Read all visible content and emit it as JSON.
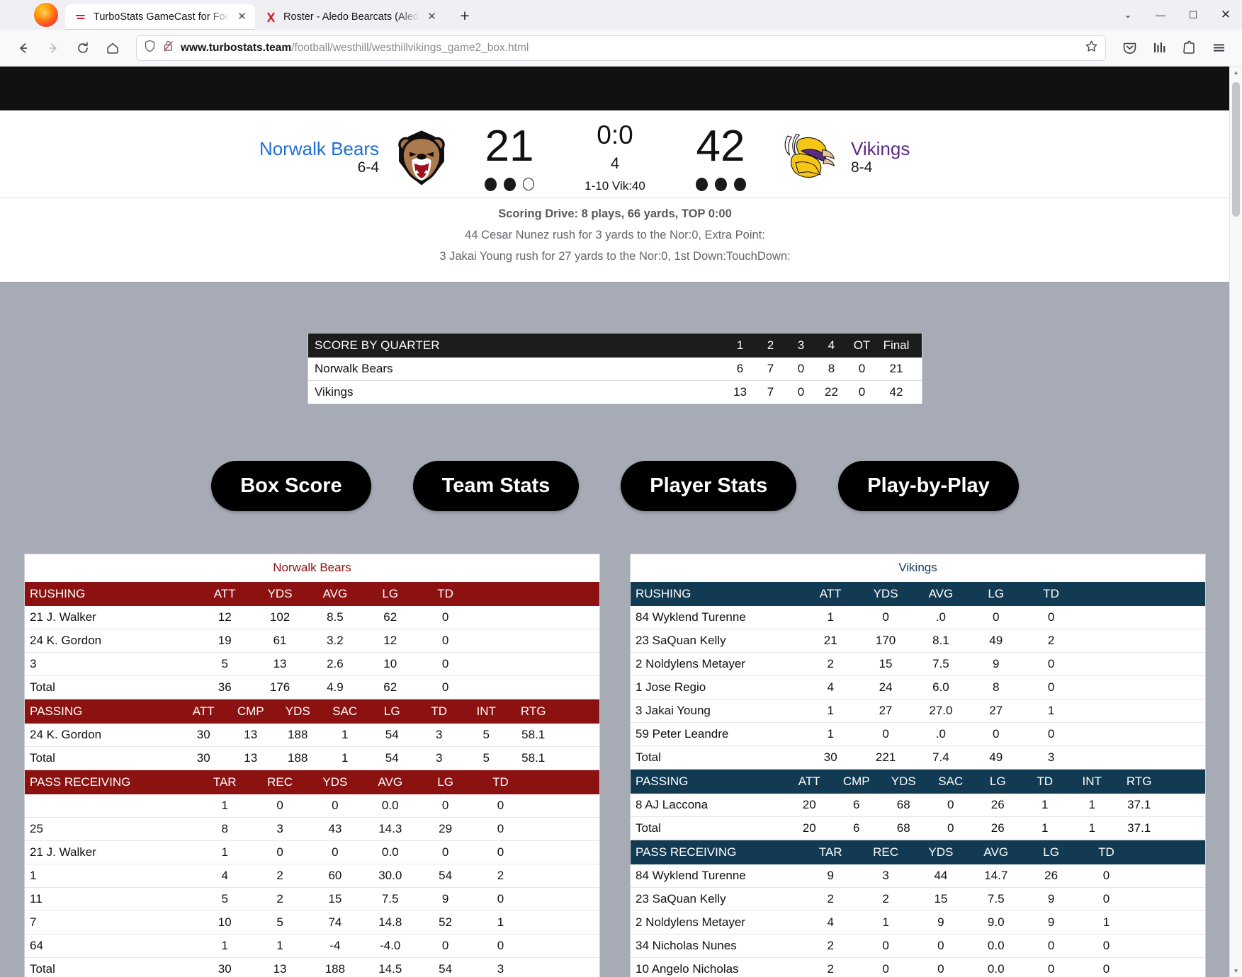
{
  "browser": {
    "tabs": [
      {
        "title": "TurboStats GameCast for Footba",
        "favicon": "turbostats-icon",
        "active": true,
        "close_label": "✕"
      },
      {
        "title": "Roster - Aledo Bearcats (Aledo,",
        "favicon": "aledo-icon",
        "active": false,
        "close_label": "✕"
      }
    ],
    "new_tab_label": "+",
    "window_controls": {
      "list_all_tabs": "⌄",
      "minimize": "—",
      "maximize": "☐",
      "close": "✕"
    },
    "nav": {
      "back": "←",
      "forward": "→",
      "reload": "⟳",
      "home": "⌂"
    },
    "url": {
      "domain": "www.turbostats.team",
      "path": "/football/westhill/westhillvikings_game2_box.html"
    },
    "toolbar_icons": [
      "shield-icon",
      "lock-slash-icon",
      "bookmark-star-icon",
      "pocket-icon",
      "library-icon",
      "extensions-icon",
      "menu-icon"
    ]
  },
  "scoreboard": {
    "away": {
      "name": "Norwalk Bears",
      "record": "6-4",
      "score": "21",
      "timeouts_used": 2,
      "timeouts_total": 3,
      "logo": "bear-head-logo"
    },
    "home": {
      "name": "Vikings",
      "record": "8-4",
      "score": "42",
      "timeouts_used": 3,
      "timeouts_total": 3,
      "logo": "viking-head-logo"
    },
    "clock": "0:0",
    "quarter": "4",
    "down_distance": "1-10 Vik:40"
  },
  "drive": {
    "title": "Scoring Drive: 8 plays, 66 yards, TOP 0:00",
    "plays": [
      "44 Cesar Nunez rush for 3 yards to the Nor:0, Extra Point:",
      "3 Jakai Young rush for 27 yards to the Nor:0, 1st Down:TouchDown:"
    ]
  },
  "score_by_quarter": {
    "title": "SCORE BY QUARTER",
    "columns": [
      "1",
      "2",
      "3",
      "4",
      "OT",
      "Final"
    ],
    "rows": [
      {
        "team": "Norwalk Bears",
        "values": [
          "6",
          "7",
          "0",
          "8",
          "0"
        ],
        "final": "21"
      },
      {
        "team": "Vikings",
        "values": [
          "13",
          "7",
          "0",
          "22",
          "0"
        ],
        "final": "42"
      }
    ]
  },
  "nav_buttons": [
    {
      "label": "Box Score"
    },
    {
      "label": "Team Stats"
    },
    {
      "label": "Player Stats"
    },
    {
      "label": "Play-by-Play"
    }
  ],
  "box_score": {
    "away": {
      "team": "Norwalk Bears",
      "accent": "#8c1111",
      "sections": [
        {
          "name": "RUSHING",
          "columns": [
            "ATT",
            "YDS",
            "AVG",
            "LG",
            "TD"
          ],
          "rows": [
            {
              "player": "21 J. Walker",
              "stats": [
                "12",
                "102",
                "8.5",
                "62",
                "0"
              ]
            },
            {
              "player": "24 K. Gordon",
              "stats": [
                "19",
                "61",
                "3.2",
                "12",
                "0"
              ]
            },
            {
              "player": "3",
              "stats": [
                "5",
                "13",
                "2.6",
                "10",
                "0"
              ]
            },
            {
              "player": "Total",
              "stats": [
                "36",
                "176",
                "4.9",
                "62",
                "0"
              ],
              "total": true
            }
          ]
        },
        {
          "name": "PASSING",
          "columns": [
            "ATT",
            "CMP",
            "YDS",
            "SAC",
            "LG",
            "TD",
            "INT",
            "RTG"
          ],
          "rows": [
            {
              "player": "24 K. Gordon",
              "stats": [
                "30",
                "13",
                "188",
                "1",
                "54",
                "3",
                "5",
                "58.1"
              ]
            },
            {
              "player": "Total",
              "stats": [
                "30",
                "13",
                "188",
                "1",
                "54",
                "3",
                "5",
                "58.1"
              ],
              "total": true
            }
          ]
        },
        {
          "name": "PASS RECEIVING",
          "columns": [
            "TAR",
            "REC",
            "YDS",
            "AVG",
            "LG",
            "TD"
          ],
          "rows": [
            {
              "player": "",
              "stats": [
                "1",
                "0",
                "0",
                "0.0",
                "0",
                "0"
              ]
            },
            {
              "player": "25",
              "stats": [
                "8",
                "3",
                "43",
                "14.3",
                "29",
                "0"
              ]
            },
            {
              "player": "21 J. Walker",
              "stats": [
                "1",
                "0",
                "0",
                "0.0",
                "0",
                "0"
              ]
            },
            {
              "player": "1",
              "stats": [
                "4",
                "2",
                "60",
                "30.0",
                "54",
                "2"
              ]
            },
            {
              "player": "11",
              "stats": [
                "5",
                "2",
                "15",
                "7.5",
                "9",
                "0"
              ]
            },
            {
              "player": "7",
              "stats": [
                "10",
                "5",
                "74",
                "14.8",
                "52",
                "1"
              ]
            },
            {
              "player": "64",
              "stats": [
                "1",
                "1",
                "-4",
                "-4.0",
                "0",
                "0"
              ]
            },
            {
              "player": "Total",
              "stats": [
                "30",
                "13",
                "188",
                "14.5",
                "54",
                "3"
              ],
              "total": true
            }
          ]
        }
      ]
    },
    "home": {
      "team": "Vikings",
      "accent": "#123a52",
      "sections": [
        {
          "name": "RUSHING",
          "columns": [
            "ATT",
            "YDS",
            "AVG",
            "LG",
            "TD"
          ],
          "rows": [
            {
              "player": "84 Wyklend Turenne",
              "stats": [
                "1",
                "0",
                ".0",
                "0",
                "0"
              ]
            },
            {
              "player": "23 SaQuan Kelly",
              "stats": [
                "21",
                "170",
                "8.1",
                "49",
                "2"
              ]
            },
            {
              "player": "2 Noldylens Metayer",
              "stats": [
                "2",
                "15",
                "7.5",
                "9",
                "0"
              ]
            },
            {
              "player": "1 Jose Regio",
              "stats": [
                "4",
                "24",
                "6.0",
                "8",
                "0"
              ]
            },
            {
              "player": "3 Jakai Young",
              "stats": [
                "1",
                "27",
                "27.0",
                "27",
                "1"
              ]
            },
            {
              "player": "59 Peter Leandre",
              "stats": [
                "1",
                "0",
                ".0",
                "0",
                "0"
              ]
            },
            {
              "player": "Total",
              "stats": [
                "30",
                "221",
                "7.4",
                "49",
                "3"
              ],
              "total": true
            }
          ]
        },
        {
          "name": "PASSING",
          "columns": [
            "ATT",
            "CMP",
            "YDS",
            "SAC",
            "LG",
            "TD",
            "INT",
            "RTG"
          ],
          "rows": [
            {
              "player": "8 AJ Laccona",
              "stats": [
                "20",
                "6",
                "68",
                "0",
                "26",
                "1",
                "1",
                "37.1"
              ]
            },
            {
              "player": "Total",
              "stats": [
                "20",
                "6",
                "68",
                "0",
                "26",
                "1",
                "1",
                "37.1"
              ],
              "total": true
            }
          ]
        },
        {
          "name": "PASS RECEIVING",
          "columns": [
            "TAR",
            "REC",
            "YDS",
            "AVG",
            "LG",
            "TD"
          ],
          "rows": [
            {
              "player": "84 Wyklend Turenne",
              "stats": [
                "9",
                "3",
                "44",
                "14.7",
                "26",
                "0"
              ]
            },
            {
              "player": "23 SaQuan Kelly",
              "stats": [
                "2",
                "2",
                "15",
                "7.5",
                "9",
                "0"
              ]
            },
            {
              "player": "2 Noldylens Metayer",
              "stats": [
                "4",
                "1",
                "9",
                "9.0",
                "9",
                "1"
              ]
            },
            {
              "player": "34 Nicholas Nunes",
              "stats": [
                "2",
                "0",
                "0",
                "0.0",
                "0",
                "0"
              ]
            },
            {
              "player": "10 Angelo Nicholas",
              "stats": [
                "2",
                "0",
                "0",
                "0.0",
                "0",
                "0"
              ]
            }
          ]
        }
      ]
    }
  }
}
